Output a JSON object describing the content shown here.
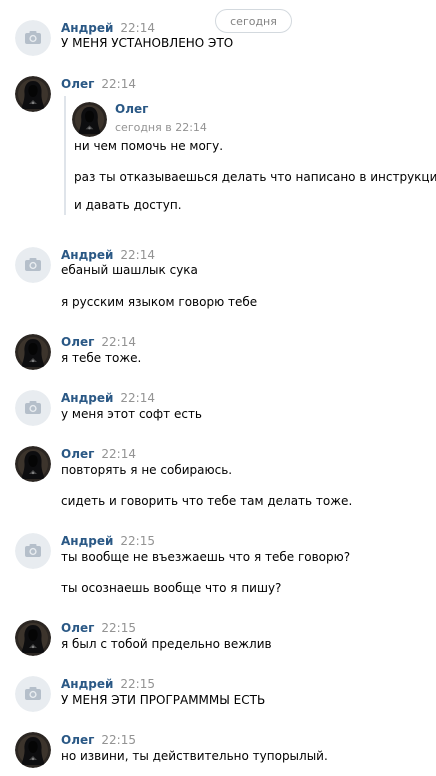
{
  "date_divider": "сегодня",
  "messages": [
    {
      "author": "Андрей",
      "time": "22:14",
      "avatar": "camera-placeholder-icon",
      "lines": [
        "У МЕНЯ УСТАНОВЛЕНО ЭТО"
      ]
    },
    {
      "author": "Олег",
      "time": "22:14",
      "avatar": "hooded-figure-avatar",
      "forwarded": {
        "author": "Олег",
        "time": "сегодня в 22:14",
        "lines": [
          "ни чем помочь не могу.",
          "раз ты отказываешься делать что написано в инструкции",
          "и давать доступ."
        ]
      }
    },
    {
      "author": "Андрей",
      "time": "22:14",
      "avatar": "camera-placeholder-icon",
      "lines": [
        "ебаный шашлык сука",
        "я русским языком говорю тебе"
      ]
    },
    {
      "author": "Олег",
      "time": "22:14",
      "avatar": "hooded-figure-avatar",
      "lines": [
        "я тебе тоже."
      ]
    },
    {
      "author": "Андрей",
      "time": "22:14",
      "avatar": "camera-placeholder-icon",
      "lines": [
        "у меня этот софт есть"
      ]
    },
    {
      "author": "Олег",
      "time": "22:14",
      "avatar": "hooded-figure-avatar",
      "lines": [
        "повторять я не собираюсь.",
        "сидеть и говорить что тебе там делать тоже."
      ]
    },
    {
      "author": "Андрей",
      "time": "22:15",
      "avatar": "camera-placeholder-icon",
      "lines": [
        "ты вообще не въезжаешь что я тебе говорю?",
        "ты осознаешь вообще что я пишу?"
      ]
    },
    {
      "author": "Олег",
      "time": "22:15",
      "avatar": "hooded-figure-avatar",
      "lines": [
        "я был с тобой предельно вежлив"
      ]
    },
    {
      "author": "Андрей",
      "time": "22:15",
      "avatar": "camera-placeholder-icon",
      "lines": [
        "У МЕНЯ ЭТИ ПРОГРАМММЫ ЕСТЬ"
      ]
    },
    {
      "author": "Олег",
      "time": "22:15",
      "avatar": "hooded-figure-avatar",
      "lines": [
        "но извини, ты действительно тупорылый."
      ]
    }
  ],
  "colors": {
    "author": "#2a5885",
    "time": "#939393",
    "text": "#000000",
    "camera_bg": "#e8ecf0",
    "camera_icon": "#b5bfca",
    "quote_bar": "#dfe4ea"
  }
}
